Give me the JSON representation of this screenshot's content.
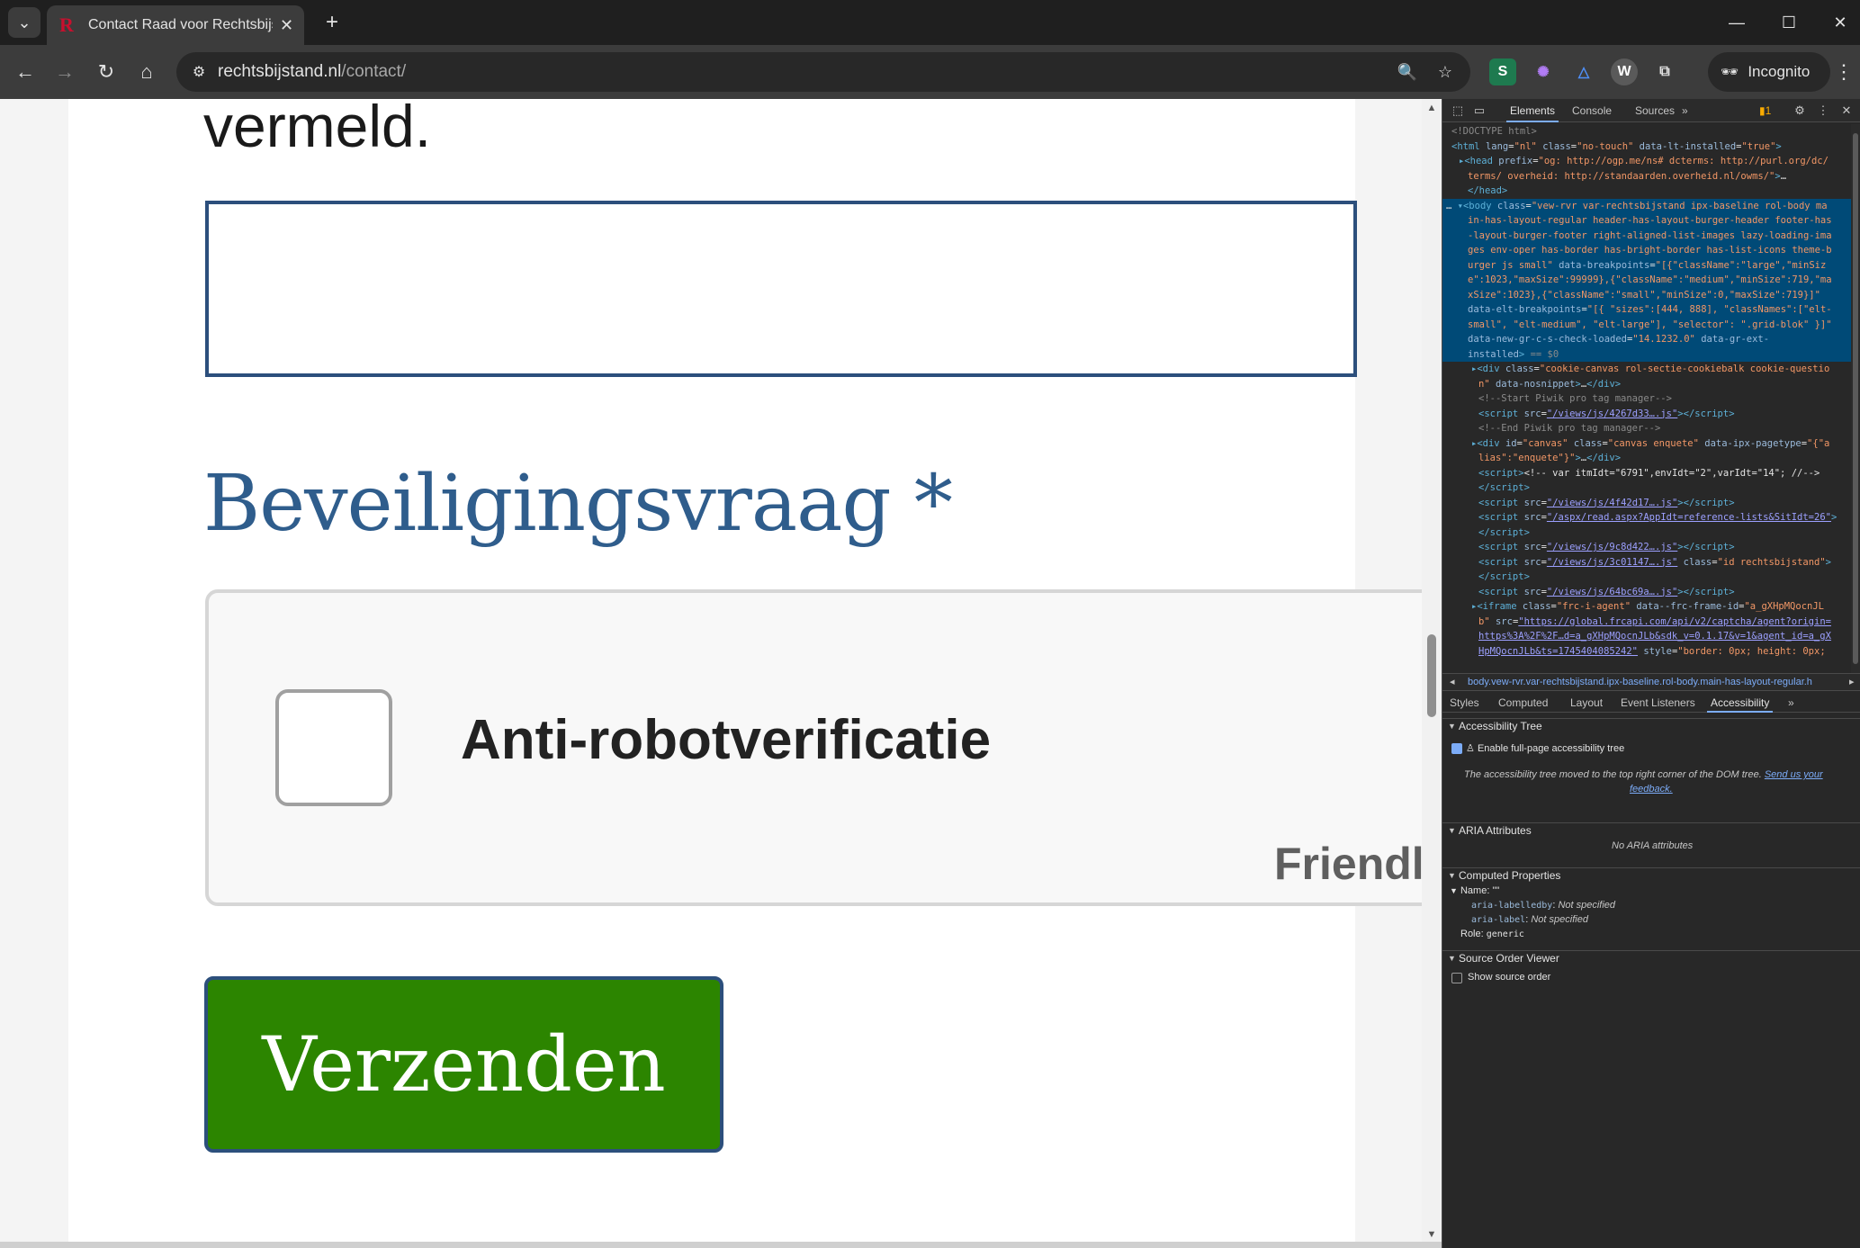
{
  "browser": {
    "tab_title": "Contact Raad voor Rechtsbijstand",
    "url_host": "rechtsbijstand.nl",
    "url_path": "/contact/",
    "incognito_label": "Incognito"
  },
  "page": {
    "intro_tail": "vermeld.",
    "security_heading": "Beveiligingsvraag *",
    "captcha_label": "Anti-robotverificatie",
    "captcha_brand": "Friendly Ca",
    "submit_label": "Verzenden"
  },
  "devtools": {
    "tabs": [
      "Elements",
      "Console",
      "Sources"
    ],
    "issues_count": "1",
    "breadcrumb": "body.vew-rvr.var-rechtsbijstand.ipx-baseline.rol-body.main-has-layout-regular.h",
    "sub_tabs": [
      "Styles",
      "Computed",
      "Layout",
      "Event Listeners",
      "Accessibility"
    ],
    "accessibility": {
      "tree_section": "Accessibility Tree",
      "enable_label": "Enable full-page accessibility tree",
      "moved_note": "The accessibility tree moved to the top right corner of the DOM tree.",
      "feedback_link_1": "Send us your",
      "feedback_link_2": "feedback.",
      "aria_section": "ARIA Attributes",
      "no_aria": "No ARIA attributes",
      "computed_section": "Computed Properties",
      "name_label": "Name: \"\"",
      "labelledby_key": "aria-labelledby",
      "labelledby_val": "Not specified",
      "label_key": "aria-label",
      "label_val": "Not specified",
      "role_key": "Role:",
      "role_val": "generic",
      "source_order_section": "Source Order Viewer",
      "show_source_order": "Show source order"
    }
  },
  "colors": {
    "heading": "#2f5d8c",
    "submit_bg": "#2c8500",
    "field_border": "#2c4f7c",
    "devtools_bg": "#282828",
    "selection": "#004a77"
  }
}
